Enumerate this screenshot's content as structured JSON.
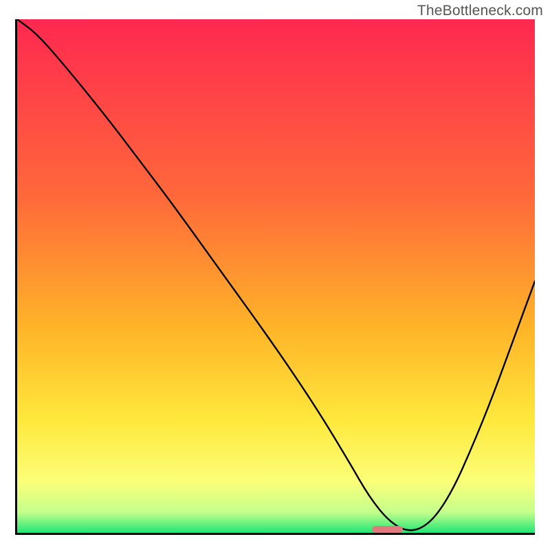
{
  "watermark": "TheBottleneck.com",
  "plot": {
    "inner_width": 753,
    "inner_height": 747
  },
  "gradient": {
    "stops": [
      {
        "pct": 0,
        "color": "#ff2850"
      },
      {
        "pct": 35,
        "color": "#ff6a3a"
      },
      {
        "pct": 60,
        "color": "#ffb428"
      },
      {
        "pct": 78,
        "color": "#ffe83c"
      },
      {
        "pct": 90,
        "color": "#fbff78"
      },
      {
        "pct": 96,
        "color": "#c4ff8c"
      },
      {
        "pct": 100,
        "color": "#20e676"
      }
    ]
  },
  "marker": {
    "x_start_frac": 0.685,
    "x_end_frac": 0.745,
    "y_frac": 0.993
  },
  "chart_data": {
    "type": "line",
    "title": "",
    "xlabel": "",
    "ylabel": "",
    "xlim": [
      0,
      100
    ],
    "ylim": [
      0,
      100
    ],
    "grid": false,
    "legend": false,
    "x": [
      0,
      4,
      10,
      18,
      24,
      30,
      40,
      50,
      58,
      64,
      68,
      72,
      76,
      80,
      84,
      88,
      92,
      96,
      100
    ],
    "values": [
      100,
      97,
      90,
      80,
      72,
      64,
      50,
      36,
      24,
      14,
      7,
      2,
      0,
      2,
      8,
      17,
      27,
      38,
      49
    ],
    "minimum_x": 72,
    "minimum_value": 0,
    "notes": "Vertical gradient background runs from red (high y) through orange/yellow to green (low y). Small rounded red marker sits at the curve minimum near x≈72. Values read from plot region (0–100 both axes, unlabeled)."
  }
}
